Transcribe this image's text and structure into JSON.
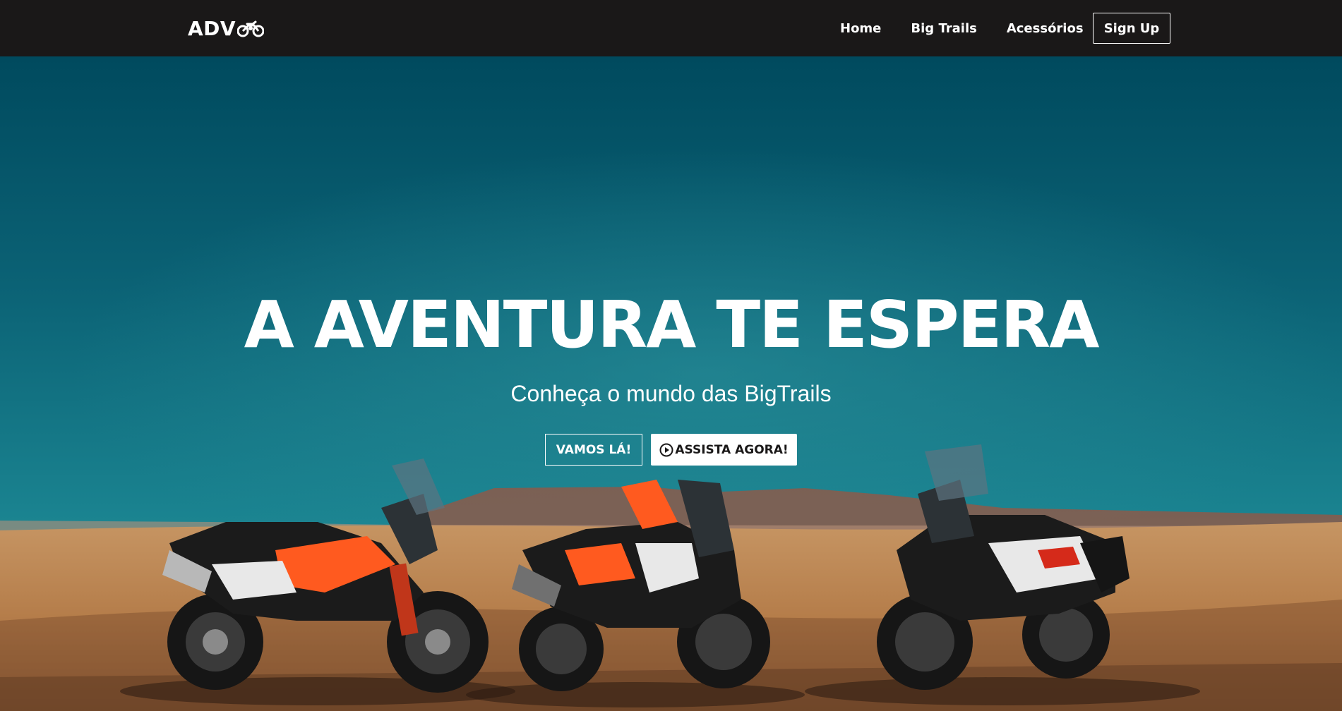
{
  "brand": {
    "name": "ADV",
    "icon": "motorcycle-icon"
  },
  "nav": {
    "links": [
      {
        "label": "Home"
      },
      {
        "label": "Big Trails"
      },
      {
        "label": "Acessórios"
      }
    ],
    "signup_label": "Sign Up"
  },
  "hero": {
    "title": "A AVENTURA TE ESPERA",
    "subtitle": "Conheça o mundo das BigTrails",
    "primary_cta": "VAMOS LÁ!",
    "secondary_cta": "ASSISTA AGORA!",
    "secondary_cta_icon": "play-circle-icon"
  },
  "colors": {
    "navbar": "#1a1818",
    "sky_top": "#004f63",
    "sky_mid": "#137b88",
    "sand": "#c08a55",
    "accent_orange": "#ff5a1f",
    "text": "#ffffff"
  }
}
